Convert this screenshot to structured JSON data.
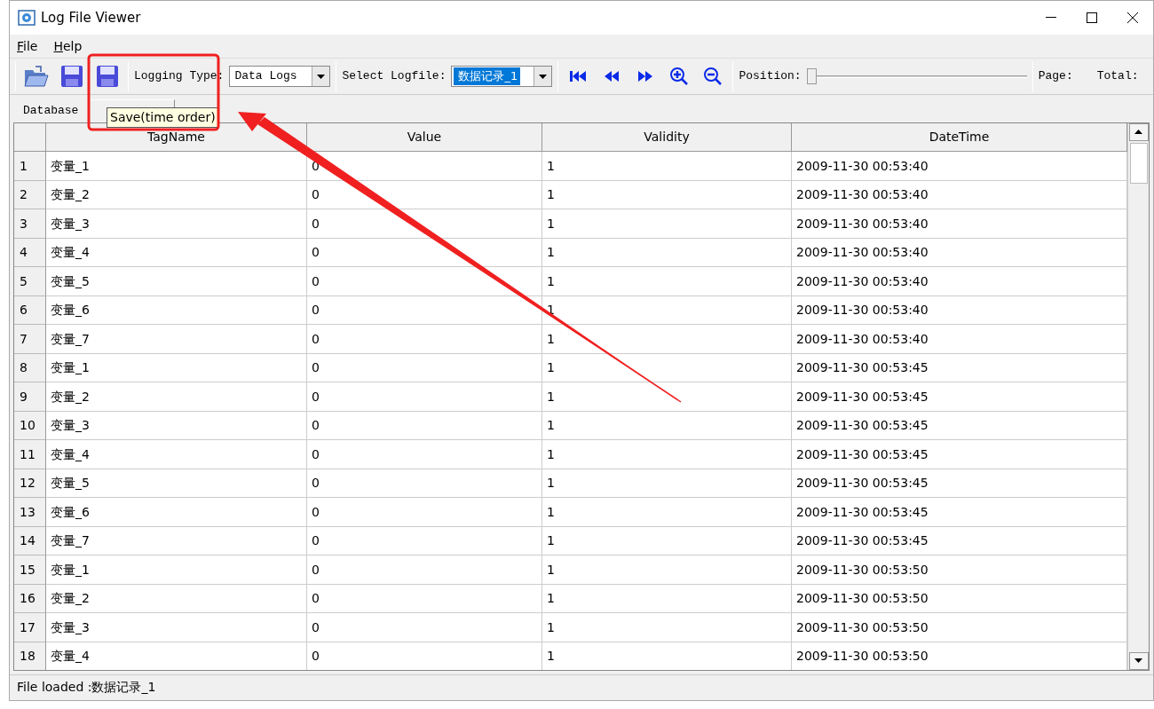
{
  "window": {
    "title": "Log File Viewer"
  },
  "menu": [
    {
      "label": "File"
    },
    {
      "label": "Help"
    }
  ],
  "toolbar": {
    "logging_type": {
      "label": "Logging Type:",
      "value": "Data Logs"
    },
    "logfile": {
      "label": "Select Logfile:",
      "value": "数据记录_1",
      "highlighted": true
    },
    "position": {
      "label": "Position:",
      "level": 0
    },
    "page_label": "Page:",
    "total_label": "Total:"
  },
  "tabs": [
    {
      "label": "Database",
      "selected": false
    },
    {
      "selected": true
    }
  ],
  "tooltip": "Save(time order)",
  "table": {
    "columns": [
      "TagName",
      "Value",
      "Validity",
      "DateTime"
    ],
    "rows": [
      {
        "number": "1",
        "cells": [
          "变量_1",
          "0",
          "1",
          "2009-11-30 00:53:40"
        ]
      },
      {
        "number": "2",
        "cells": [
          "变量_2",
          "0",
          "1",
          "2009-11-30 00:53:40"
        ]
      },
      {
        "number": "3",
        "cells": [
          "变量_3",
          "0",
          "1",
          "2009-11-30 00:53:40"
        ]
      },
      {
        "number": "4",
        "cells": [
          "变量_4",
          "0",
          "1",
          "2009-11-30 00:53:40"
        ]
      },
      {
        "number": "5",
        "cells": [
          "变量_5",
          "0",
          "1",
          "2009-11-30 00:53:40"
        ]
      },
      {
        "number": "6",
        "cells": [
          "变量_6",
          "0",
          "1",
          "2009-11-30 00:53:40"
        ]
      },
      {
        "number": "7",
        "cells": [
          "变量_7",
          "0",
          "1",
          "2009-11-30 00:53:40"
        ]
      },
      {
        "number": "8",
        "cells": [
          "变量_1",
          "0",
          "1",
          "2009-11-30 00:53:45"
        ]
      },
      {
        "number": "9",
        "cells": [
          "变量_2",
          "0",
          "1",
          "2009-11-30 00:53:45"
        ]
      },
      {
        "number": "10",
        "cells": [
          "变量_3",
          "0",
          "1",
          "2009-11-30 00:53:45"
        ]
      },
      {
        "number": "11",
        "cells": [
          "变量_4",
          "0",
          "1",
          "2009-11-30 00:53:45"
        ]
      },
      {
        "number": "12",
        "cells": [
          "变量_5",
          "0",
          "1",
          "2009-11-30 00:53:45"
        ]
      },
      {
        "number": "13",
        "cells": [
          "变量_6",
          "0",
          "1",
          "2009-11-30 00:53:45"
        ]
      },
      {
        "number": "14",
        "cells": [
          "变量_7",
          "0",
          "1",
          "2009-11-30 00:53:45"
        ]
      },
      {
        "number": "15",
        "cells": [
          "变量_1",
          "0",
          "1",
          "2009-11-30 00:53:50"
        ]
      },
      {
        "number": "16",
        "cells": [
          "变量_2",
          "0",
          "1",
          "2009-11-30 00:53:50"
        ]
      },
      {
        "number": "17",
        "cells": [
          "变量_3",
          "0",
          "1",
          "2009-11-30 00:53:50"
        ]
      },
      {
        "number": "18",
        "cells": [
          "变量_4",
          "0",
          "1",
          "2009-11-30 00:53:50"
        ]
      }
    ]
  },
  "status_bar": {
    "text": "File loaded :数据记录_1"
  }
}
